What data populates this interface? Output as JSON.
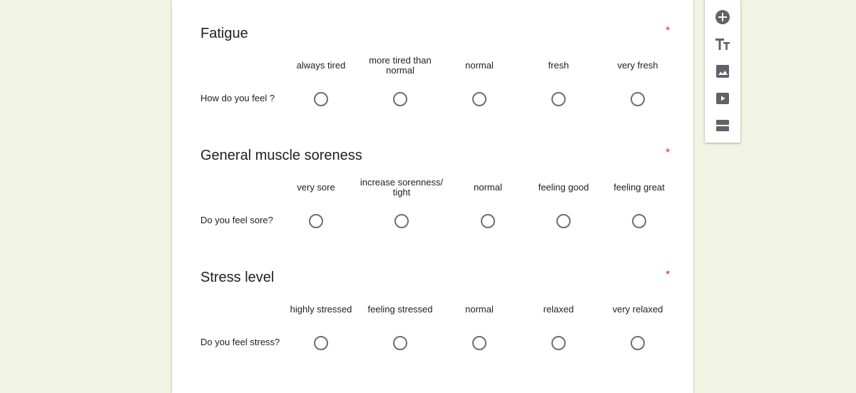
{
  "questions": [
    {
      "title": "Fatigue",
      "required_mark": "*",
      "columns": [
        "always tired",
        "more tired than normal",
        "normal",
        "fresh",
        "very fresh"
      ],
      "row": "How do you feel ?"
    },
    {
      "title": "General muscle soreness",
      "required_mark": "*",
      "columns": [
        "very sore",
        "increase sorenness/ tight",
        "normal",
        "feeling good",
        "feeling great"
      ],
      "row": "Do you feel sore?"
    },
    {
      "title": "Stress level",
      "required_mark": "*",
      "columns": [
        "highly stressed",
        "feeling stressed",
        "normal",
        "relaxed",
        "very relaxed"
      ],
      "row": "Do you feel stress?"
    }
  ],
  "toolbar": {
    "icons": [
      "add-question-icon",
      "add-title-icon",
      "add-image-icon",
      "add-video-icon",
      "add-section-icon"
    ],
    "icon_color": "#5f6368"
  },
  "colors": {
    "background": "#f2f4e3",
    "required": "#d93025"
  }
}
